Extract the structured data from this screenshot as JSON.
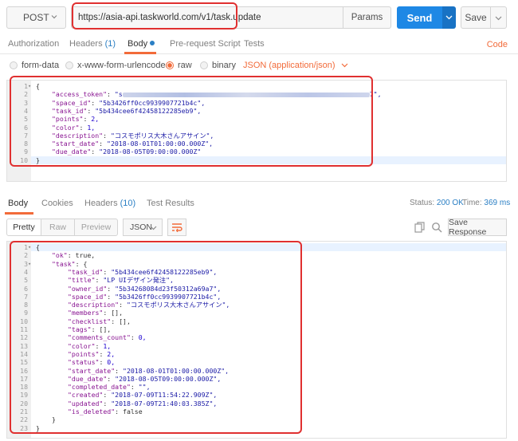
{
  "request": {
    "method": "POST",
    "url": "https://asia-api.taskworld.com/v1/task.update",
    "params_label": "Params",
    "send_label": "Send",
    "save_label": "Save"
  },
  "request_tabs": [
    {
      "label": "Authorization"
    },
    {
      "label": "Headers",
      "count": "(1)"
    },
    {
      "label": "Body",
      "active": true
    },
    {
      "label": "Pre-request Script"
    },
    {
      "label": "Tests"
    }
  ],
  "code_label": "Code",
  "body_types": [
    {
      "label": "form-data"
    },
    {
      "label": "x-www-form-urlencoded"
    },
    {
      "label": "raw",
      "selected": true
    },
    {
      "label": "binary"
    }
  ],
  "content_type": "JSON (application/json)",
  "request_body": [
    {
      "n": "1",
      "text": "{",
      "fold": true
    },
    {
      "n": "2",
      "key": "\"access_token\"",
      "val": "\"s",
      "redacted": true,
      "tail": "7\","
    },
    {
      "n": "3",
      "key": "\"space_id\"",
      "val": "\"5b3426ff0cc9939907721b4c\","
    },
    {
      "n": "4",
      "key": "\"task_id\"",
      "val": "\"5b434cee6f42458122285eb9\","
    },
    {
      "n": "5",
      "key": "\"points\"",
      "num": "2,"
    },
    {
      "n": "6",
      "key": "\"color\"",
      "num": "1,"
    },
    {
      "n": "7",
      "key": "\"description\"",
      "val": "\"コスモポリス大木さんアサイン\","
    },
    {
      "n": "8",
      "key": "\"start_date\"",
      "val": "\"2018-08-01T01:00:00.000Z\","
    },
    {
      "n": "9",
      "key": "\"due_date\"",
      "val": "\"2018-08-05T09:00:00.000Z\""
    },
    {
      "n": "10",
      "text": "}"
    }
  ],
  "response_tabs": [
    {
      "label": "Body",
      "active": true
    },
    {
      "label": "Cookies"
    },
    {
      "label": "Headers",
      "count": "(10)"
    },
    {
      "label": "Test Results"
    }
  ],
  "status": {
    "label": "Status:",
    "value": "200 OK",
    "time_label": "Time:",
    "time_value": "369 ms"
  },
  "view_modes": [
    "Pretty",
    "Raw",
    "Preview"
  ],
  "format": "JSON",
  "save_response_label": "Save Response",
  "response_body": [
    {
      "n": "1",
      "text": "{",
      "fold": true
    },
    {
      "n": "2",
      "ind": 1,
      "key": "\"ok\"",
      "lit": "true,"
    },
    {
      "n": "3",
      "ind": 1,
      "key": "\"task\"",
      "lit": "{",
      "fold": true
    },
    {
      "n": "4",
      "ind": 2,
      "key": "\"task_id\"",
      "val": "\"5b434cee6f42458122285eb9\","
    },
    {
      "n": "5",
      "ind": 2,
      "key": "\"title\"",
      "val": "\"LP UIデザイン発注\","
    },
    {
      "n": "6",
      "ind": 2,
      "key": "\"owner_id\"",
      "val": "\"5b34268084d23f50312a69a7\","
    },
    {
      "n": "7",
      "ind": 2,
      "key": "\"space_id\"",
      "val": "\"5b3426ff0cc9939907721b4c\","
    },
    {
      "n": "8",
      "ind": 2,
      "key": "\"description\"",
      "val": "\"コスモポリス大木さんアサイン\","
    },
    {
      "n": "9",
      "ind": 2,
      "key": "\"members\"",
      "lit": "[],"
    },
    {
      "n": "10",
      "ind": 2,
      "key": "\"checklist\"",
      "lit": "[],"
    },
    {
      "n": "11",
      "ind": 2,
      "key": "\"tags\"",
      "lit": "[],"
    },
    {
      "n": "12",
      "ind": 2,
      "key": "\"comments_count\"",
      "num": "0,"
    },
    {
      "n": "13",
      "ind": 2,
      "key": "\"color\"",
      "num": "1,"
    },
    {
      "n": "14",
      "ind": 2,
      "key": "\"points\"",
      "num": "2,"
    },
    {
      "n": "15",
      "ind": 2,
      "key": "\"status\"",
      "num": "0,"
    },
    {
      "n": "16",
      "ind": 2,
      "key": "\"start_date\"",
      "val": "\"2018-08-01T01:00:00.000Z\","
    },
    {
      "n": "17",
      "ind": 2,
      "key": "\"due_date\"",
      "val": "\"2018-08-05T09:00:00.000Z\","
    },
    {
      "n": "18",
      "ind": 2,
      "key": "\"completed_date\"",
      "val": "\"\","
    },
    {
      "n": "19",
      "ind": 2,
      "key": "\"created\"",
      "val": "\"2018-07-09T11:54:22.909Z\","
    },
    {
      "n": "20",
      "ind": 2,
      "key": "\"updated\"",
      "val": "\"2018-07-09T21:40:03.385Z\","
    },
    {
      "n": "21",
      "ind": 2,
      "key": "\"is_deleted\"",
      "lit": "false"
    },
    {
      "n": "22",
      "ind": 1,
      "text": "}"
    },
    {
      "n": "23",
      "text": "}"
    }
  ],
  "colors": {
    "accent": "#f26b3a",
    "send": "#1e88e5",
    "highlight": "#e03030"
  }
}
